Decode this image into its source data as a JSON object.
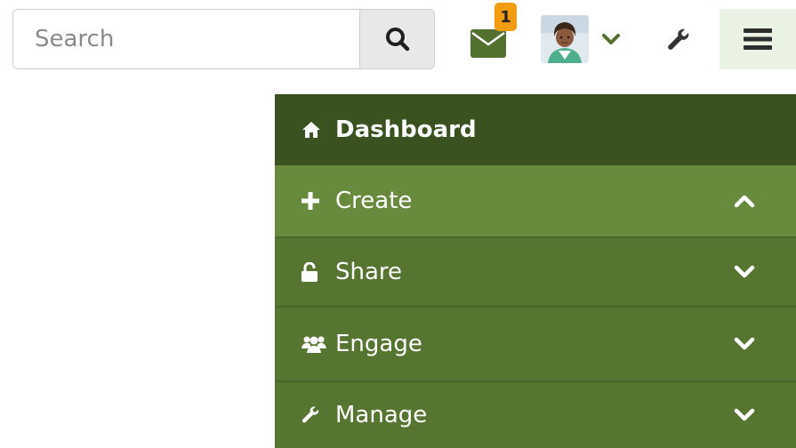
{
  "search": {
    "placeholder": "Search",
    "button_icon": "search-icon"
  },
  "header": {
    "messages": {
      "icon": "envelope-icon",
      "badge_count": "1",
      "badge_color": "#f39c12"
    },
    "user": {
      "avatar": "avatar",
      "chevron": "chevron-down-icon"
    },
    "tools": {
      "icon": "wrench-icon"
    },
    "menu": {
      "icon": "hamburger-icon",
      "active_bg": "#eaf2e3"
    }
  },
  "nav": {
    "colors": {
      "dashboard_bg": "#3a5220",
      "active_bg": "#678a3c",
      "item_bg": "#557530",
      "text": "#ffffff"
    },
    "items": [
      {
        "label": "Dashboard",
        "icon": "home-icon"
      },
      {
        "label": "Create",
        "icon": "plus-icon",
        "chevron": "chevron-up-icon"
      },
      {
        "label": "Share",
        "icon": "unlock-icon",
        "chevron": "chevron-down-icon"
      },
      {
        "label": "Engage",
        "icon": "users-icon",
        "chevron": "chevron-down-icon"
      },
      {
        "label": "Manage",
        "icon": "wrench-icon",
        "chevron": "chevron-down-icon"
      }
    ]
  }
}
